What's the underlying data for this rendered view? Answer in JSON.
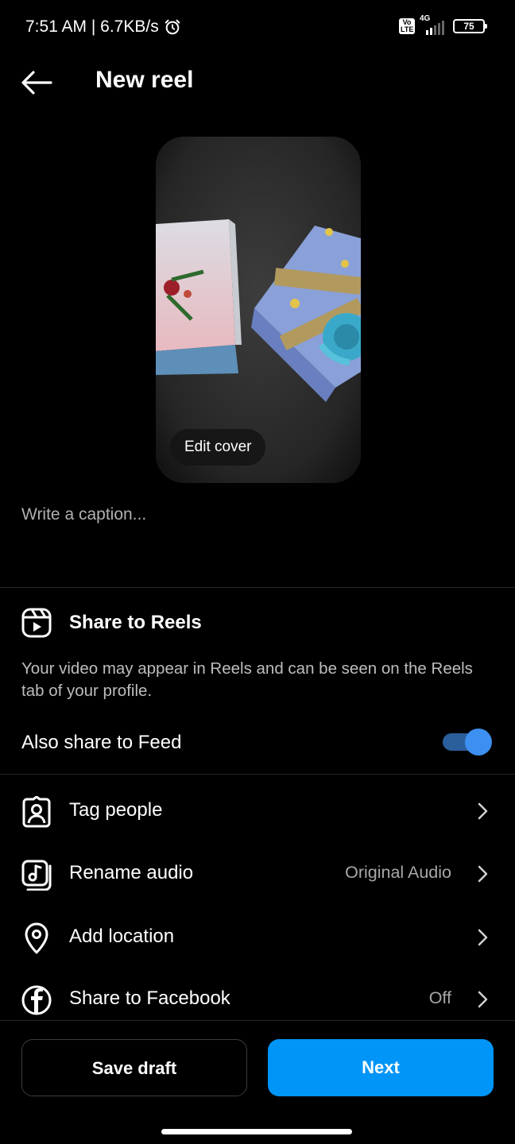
{
  "status_bar": {
    "time_speed": "7:51 AM | 6.7KB/s",
    "volte": "Vo LTE",
    "network": "4G",
    "battery": "75"
  },
  "header": {
    "title": "New reel",
    "back_icon": "arrow-left-icon"
  },
  "preview": {
    "edit_cover_label": "Edit cover"
  },
  "caption": {
    "placeholder": "Write a caption..."
  },
  "reels": {
    "title": "Share to Reels",
    "description": "Your video may appear in Reels and can be seen on the Reels tab of your profile.",
    "icon": "reels-icon"
  },
  "feed": {
    "label": "Also share to Feed",
    "enabled": true,
    "accent": "#3d8ff0"
  },
  "options": [
    {
      "label": "Tag people",
      "value": "",
      "icon": "tag-person-icon"
    },
    {
      "label": "Rename audio",
      "value": "Original Audio",
      "icon": "music-note-icon"
    },
    {
      "label": "Add location",
      "value": "",
      "icon": "location-pin-icon"
    },
    {
      "label": "Share to Facebook",
      "value": "Off",
      "icon": "facebook-icon"
    }
  ],
  "actions": {
    "save_draft": "Save draft",
    "next": "Next",
    "next_color": "#0095f6"
  }
}
